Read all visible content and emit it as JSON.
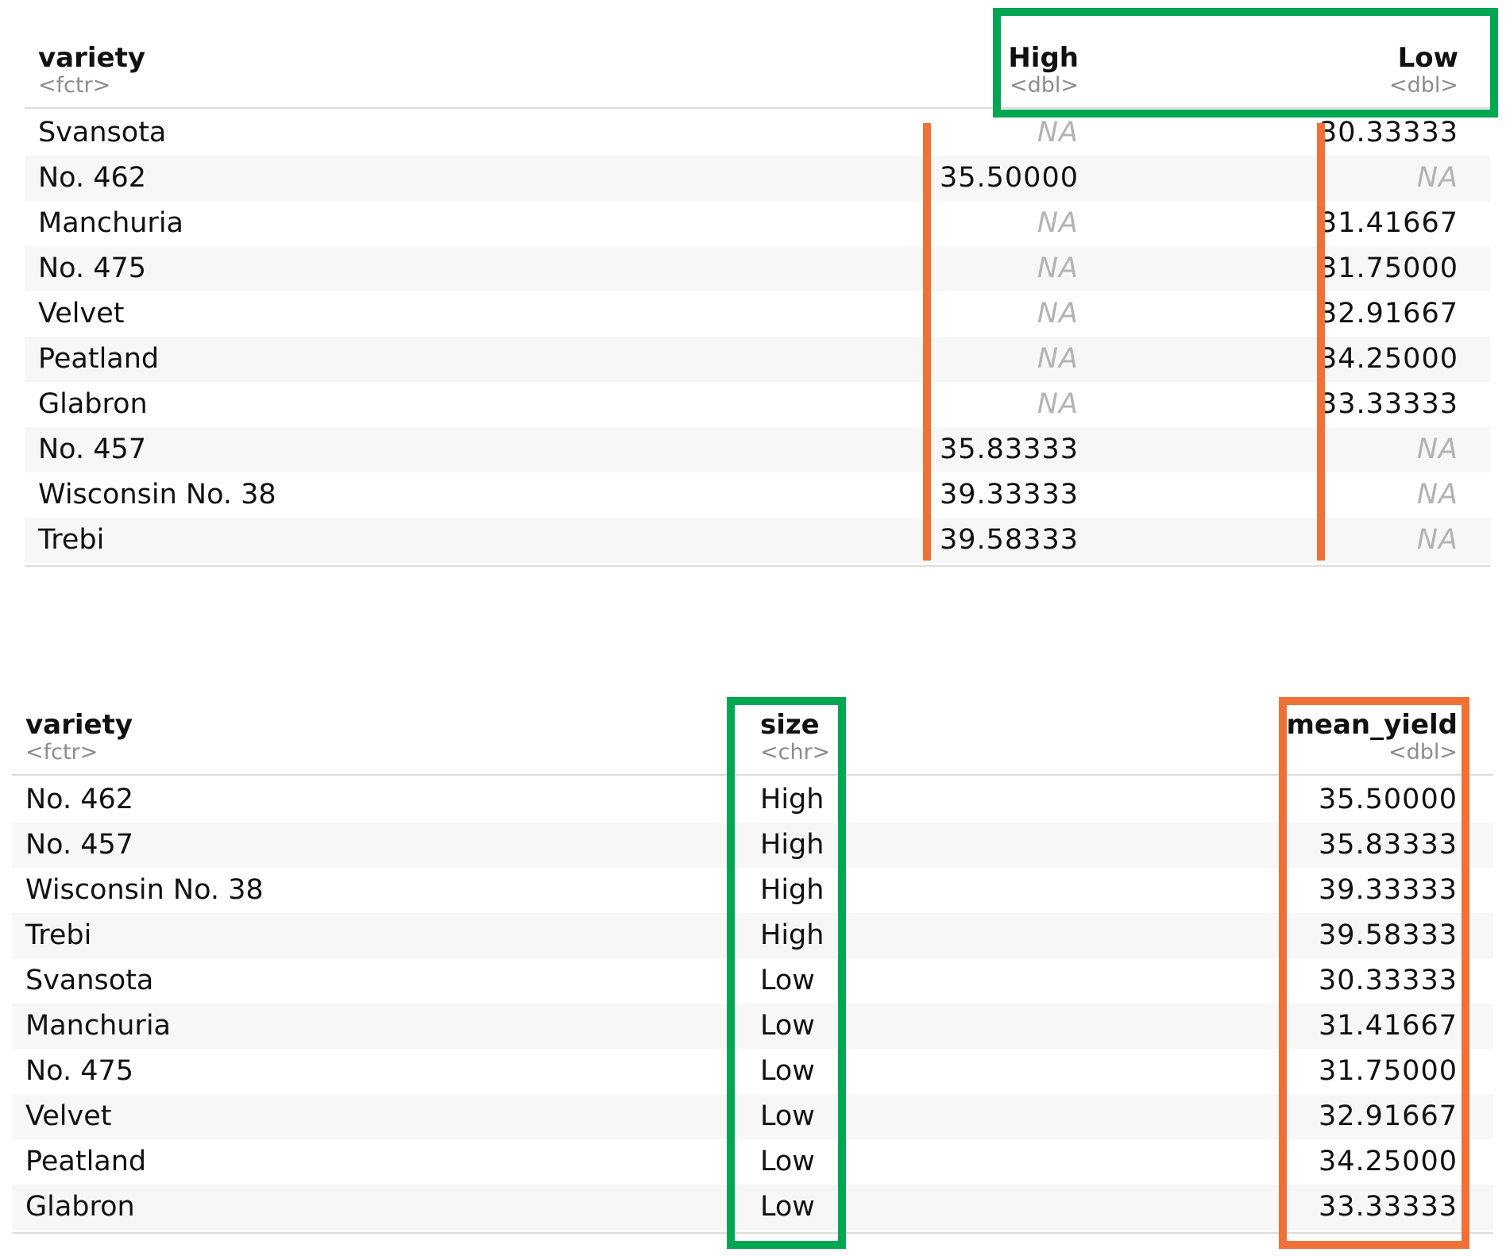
{
  "colors": {
    "highlight_green": "#00a651",
    "highlight_orange": "#f07137",
    "na_gray": "#b3b3b3",
    "type_gray": "#8c8c8c",
    "stripe": "#f7f7f7",
    "rule": "#dcdcdc"
  },
  "wide_table": {
    "columns": [
      {
        "name": "variety",
        "type": "<fctr>"
      },
      {
        "name": "High",
        "type": "<dbl>"
      },
      {
        "name": "Low",
        "type": "<dbl>"
      }
    ],
    "rows": [
      {
        "variety": "Svansota",
        "high": "NA",
        "low": "30.33333"
      },
      {
        "variety": "No. 462",
        "high": "35.50000",
        "low": "NA"
      },
      {
        "variety": "Manchuria",
        "high": "NA",
        "low": "31.41667"
      },
      {
        "variety": "No. 475",
        "high": "NA",
        "low": "31.75000"
      },
      {
        "variety": "Velvet",
        "high": "NA",
        "low": "32.91667"
      },
      {
        "variety": "Peatland",
        "high": "NA",
        "low": "34.25000"
      },
      {
        "variety": "Glabron",
        "high": "NA",
        "low": "33.33333"
      },
      {
        "variety": "No. 457",
        "high": "35.83333",
        "low": "NA"
      },
      {
        "variety": "Wisconsin No. 38",
        "high": "39.33333",
        "low": "NA"
      },
      {
        "variety": "Trebi",
        "high": "39.58333",
        "low": "NA"
      }
    ]
  },
  "long_table": {
    "columns": [
      {
        "name": "variety",
        "type": "<fctr>"
      },
      {
        "name": "size",
        "type": "<chr>"
      },
      {
        "name": "mean_yield",
        "type": "<dbl>"
      }
    ],
    "rows": [
      {
        "variety": "No. 462",
        "size": "High",
        "mean_yield": "35.50000"
      },
      {
        "variety": "No. 457",
        "size": "High",
        "mean_yield": "35.83333"
      },
      {
        "variety": "Wisconsin No. 38",
        "size": "High",
        "mean_yield": "39.33333"
      },
      {
        "variety": "Trebi",
        "size": "High",
        "mean_yield": "39.58333"
      },
      {
        "variety": "Svansota",
        "size": "Low",
        "mean_yield": "30.33333"
      },
      {
        "variety": "Manchuria",
        "size": "Low",
        "mean_yield": "31.41667"
      },
      {
        "variety": "No. 475",
        "size": "Low",
        "mean_yield": "31.75000"
      },
      {
        "variety": "Velvet",
        "size": "Low",
        "mean_yield": "32.91667"
      },
      {
        "variety": "Peatland",
        "size": "Low",
        "mean_yield": "34.25000"
      },
      {
        "variety": "Glabron",
        "size": "Low",
        "mean_yield": "33.33333"
      }
    ]
  }
}
